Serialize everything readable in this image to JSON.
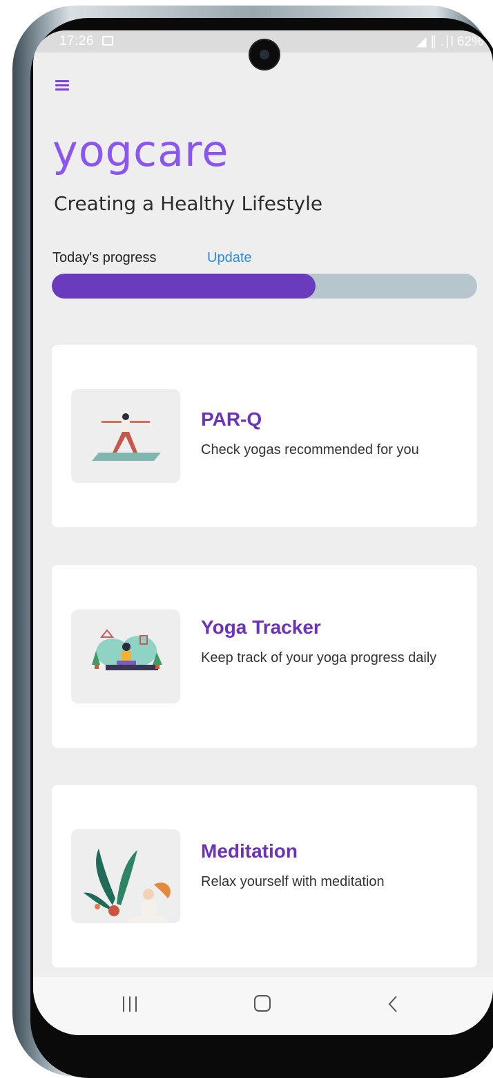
{
  "status_bar": {
    "time": "17:26",
    "right_text": "◢ ∥ .∣l 62%"
  },
  "app": {
    "title": "yogcare",
    "tagline": "Creating a Healthy Lifestyle",
    "accent_color": "#6a33b8",
    "brand_color": "#8a55f0"
  },
  "progress": {
    "label": "Today's progress",
    "update_label": "Update",
    "value_percent": 62
  },
  "cards": [
    {
      "title": "PAR-Q",
      "description": "Check yogas recommended for you",
      "icon": "warrior-pose-illustration"
    },
    {
      "title": "Yoga Tracker",
      "description": "Keep track of your yoga progress daily",
      "icon": "yoga-room-illustration"
    },
    {
      "title": "Meditation",
      "description": "Relax yourself with meditation",
      "icon": "meditation-illustration"
    }
  ],
  "nav": {
    "recents_icon": "recents-icon",
    "home_icon": "home-icon",
    "back_icon": "back-icon"
  }
}
